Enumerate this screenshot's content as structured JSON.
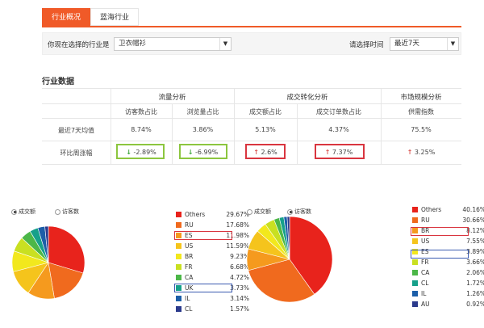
{
  "tabs": [
    {
      "label": "行业概况",
      "active": true
    },
    {
      "label": "蓝海行业",
      "active": false
    }
  ],
  "filter": {
    "industry_label": "你现在选择的行业是",
    "industry_value": "卫衣帽衫",
    "time_label": "请选择时间",
    "time_value": "最近7天"
  },
  "section_title": "行业数据",
  "table": {
    "groups": [
      "流量分析",
      "成交转化分析",
      "市场规模分析"
    ],
    "columns": [
      "访客数占比",
      "浏览量占比",
      "成交额占比",
      "成交订单数占比",
      "供需指数"
    ],
    "rows": [
      {
        "label": "最近7天均值",
        "values": [
          "8.74%",
          "3.86%",
          "5.13%",
          "4.37%",
          "75.5%"
        ]
      },
      {
        "label": "环比周涨幅",
        "values": [
          "-2.89%",
          "-6.99%",
          "2.6%",
          "7.37%",
          "3.25%"
        ],
        "arrows": [
          "↓",
          "↓",
          "↑",
          "↑",
          "↑"
        ],
        "colors": [
          "#3aa53a",
          "#3aa53a",
          "#d9534f",
          "#d9534f",
          "#d9534f"
        ]
      }
    ]
  },
  "left_chart": {
    "radio_options": [
      {
        "label": "成交额",
        "selected": true
      },
      {
        "label": "访客数",
        "selected": false
      }
    ],
    "chart_data": {
      "type": "pie",
      "categories": [
        "Others",
        "RU",
        "ES",
        "US",
        "BR",
        "FR",
        "CA",
        "UK",
        "IL",
        "CL"
      ],
      "values": [
        29.67,
        17.68,
        11.98,
        11.59,
        9.23,
        6.68,
        4.72,
        3.73,
        3.14,
        1.57
      ],
      "labels": [
        "29.67%",
        "17.68%",
        "11.98%",
        "11.59%",
        "9.23%",
        "6.68%",
        "4.72%",
        "3.73%",
        "3.14%",
        "1.57%"
      ],
      "colors": [
        "#e8231c",
        "#f06a1e",
        "#f59a1e",
        "#f5c41c",
        "#f2e81d",
        "#c9e021",
        "#4cb748",
        "#16a08a",
        "#1c5ea8",
        "#2b3a8c"
      ]
    }
  },
  "right_chart": {
    "radio_options": [
      {
        "label": "成交额",
        "selected": false
      },
      {
        "label": "访客数",
        "selected": true
      }
    ],
    "chart_data": {
      "type": "pie",
      "categories": [
        "Others",
        "RU",
        "BR",
        "US",
        "ES",
        "FR",
        "CA",
        "CL",
        "IL",
        "AU"
      ],
      "values": [
        40.16,
        30.66,
        8.12,
        7.55,
        3.89,
        3.66,
        2.06,
        1.72,
        1.26,
        0.92
      ],
      "labels": [
        "40.16%",
        "30.66%",
        "8.12%",
        "7.55%",
        "3.89%",
        "3.66%",
        "2.06%",
        "1.72%",
        "1.26%",
        "0.92%"
      ],
      "colors": [
        "#e8231c",
        "#f06a1e",
        "#f59a1e",
        "#f5c41c",
        "#f2e81d",
        "#c9e021",
        "#4cb748",
        "#16a08a",
        "#1c5ea8",
        "#2b3a8c"
      ]
    }
  }
}
